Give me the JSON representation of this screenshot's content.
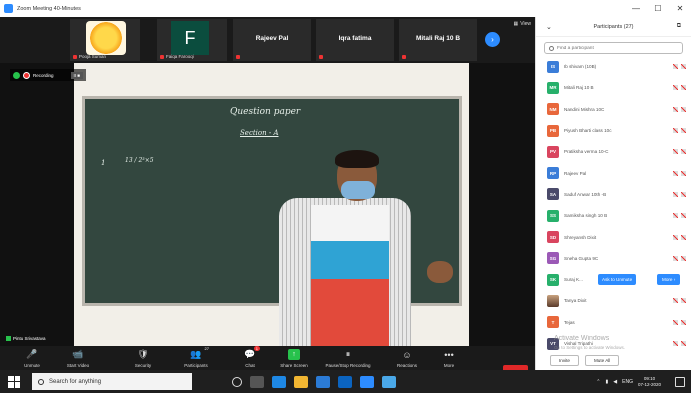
{
  "window": {
    "title": "Zoom Meeting 40-Minutes",
    "controls": [
      "—",
      "☐",
      "✕"
    ]
  },
  "thumbnails": [
    {
      "name": "Pooja Suman",
      "has_image": true
    },
    {
      "name": "Faiqa Farooqi",
      "initial": "F"
    },
    {
      "name": "Rajeev Pal"
    },
    {
      "name": "Iqra fatima"
    },
    {
      "name": "Mitali Raj 10 B"
    }
  ],
  "view_label": "View",
  "recording": {
    "label": "Recording",
    "control": "II ■"
  },
  "board": {
    "title": "Question paper",
    "subtitle": "Section - A",
    "q1_num": "1",
    "q1_expr": "13 / 2³×5"
  },
  "speaker_name": "Pintu Srivastava",
  "toolbar": {
    "items": [
      {
        "label": "Unmute",
        "icon": "🎤"
      },
      {
        "label": "Start Video",
        "icon": "📹"
      },
      {
        "label": "Security",
        "icon": "🛡"
      },
      {
        "label": "Participants",
        "icon": "👥",
        "count": "27"
      },
      {
        "label": "Chat",
        "icon": "💬",
        "badge": "1"
      },
      {
        "label": "Share Screen",
        "icon": "↑"
      },
      {
        "label": "Pause/Stop Recording",
        "icon": "⏸"
      },
      {
        "label": "Reactions",
        "icon": "☺"
      },
      {
        "label": "More",
        "icon": "•••"
      }
    ],
    "end_label": "End"
  },
  "participants_panel": {
    "title": "Participants (27)",
    "search_placeholder": "Find a participant",
    "rows": [
      {
        "initials": "IS",
        "color": "#3b7dd8",
        "name": "Ib shivam (10B)"
      },
      {
        "initials": "MR",
        "color": "#27b06b",
        "name": "Mitali Raj 10 B"
      },
      {
        "initials": "NM",
        "color": "#e8673b",
        "name": "Nandini Mishra 10C"
      },
      {
        "initials": "PB",
        "color": "#e8673b",
        "name": "Piyush Bharti class 10c"
      },
      {
        "initials": "PV",
        "color": "#d9455f",
        "name": "Pratiksha verma 10-C"
      },
      {
        "initials": "RP",
        "color": "#3b7dd8",
        "name": "Rajeev Pal"
      },
      {
        "initials": "SA",
        "color": "#4a4a6a",
        "name": "Saduf Anwar 10th -B"
      },
      {
        "initials": "SS",
        "color": "#27b06b",
        "name": "Samiksha singh 10 B"
      },
      {
        "initials": "SD",
        "color": "#d9455f",
        "name": "Shreyansh Dixit"
      },
      {
        "initials": "SG",
        "color": "#9b59b6",
        "name": "Sneha Gupta 9C"
      },
      {
        "initials": "SK",
        "color": "#27b06b",
        "name": "Suraj K..."
      },
      {
        "initials": "",
        "color": "#777",
        "name": "Tanya Dixit",
        "photo": true
      },
      {
        "initials": "T",
        "color": "#e8673b",
        "name": "Tejas"
      },
      {
        "initials": "VT",
        "color": "#4a4a6a",
        "name": "Vishal Tripathi"
      }
    ],
    "ask_to_unmute": "Ask to Unmute",
    "more": "More ›",
    "footer": {
      "invite": "Invite",
      "mute_all": "Mute All"
    },
    "watermark_title": "Activate Windows",
    "watermark_sub": "Go to Settings to activate Windows."
  },
  "taskbar": {
    "search_placeholder": "Search for anything",
    "time": "09:10",
    "date": "07-12-2020",
    "lang": "ENG"
  }
}
